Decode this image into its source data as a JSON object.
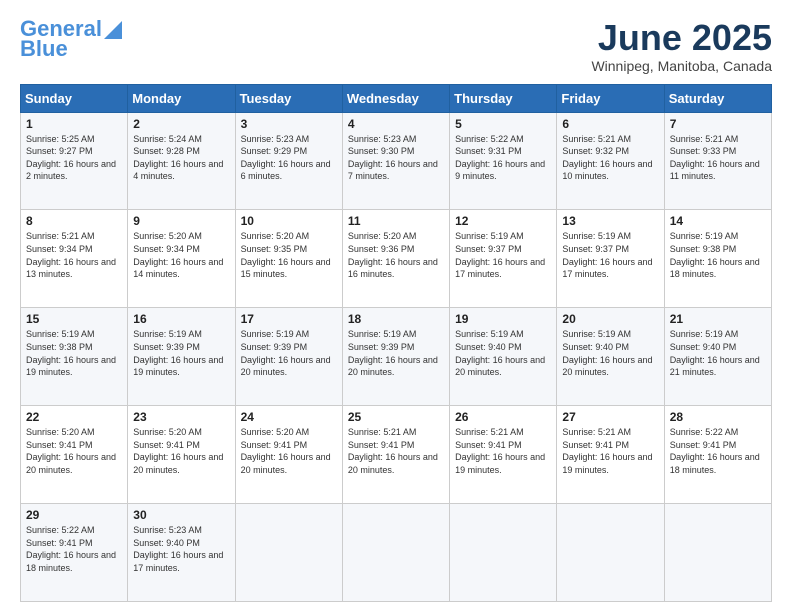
{
  "logo": {
    "line1": "General",
    "line2": "Blue"
  },
  "header": {
    "month": "June 2025",
    "location": "Winnipeg, Manitoba, Canada"
  },
  "days_of_week": [
    "Sunday",
    "Monday",
    "Tuesday",
    "Wednesday",
    "Thursday",
    "Friday",
    "Saturday"
  ],
  "weeks": [
    [
      {
        "day": "1",
        "sunrise": "5:25 AM",
        "sunset": "9:27 PM",
        "daylight": "16 hours and 2 minutes."
      },
      {
        "day": "2",
        "sunrise": "5:24 AM",
        "sunset": "9:28 PM",
        "daylight": "16 hours and 4 minutes."
      },
      {
        "day": "3",
        "sunrise": "5:23 AM",
        "sunset": "9:29 PM",
        "daylight": "16 hours and 6 minutes."
      },
      {
        "day": "4",
        "sunrise": "5:23 AM",
        "sunset": "9:30 PM",
        "daylight": "16 hours and 7 minutes."
      },
      {
        "day": "5",
        "sunrise": "5:22 AM",
        "sunset": "9:31 PM",
        "daylight": "16 hours and 9 minutes."
      },
      {
        "day": "6",
        "sunrise": "5:21 AM",
        "sunset": "9:32 PM",
        "daylight": "16 hours and 10 minutes."
      },
      {
        "day": "7",
        "sunrise": "5:21 AM",
        "sunset": "9:33 PM",
        "daylight": "16 hours and 11 minutes."
      }
    ],
    [
      {
        "day": "8",
        "sunrise": "5:21 AM",
        "sunset": "9:34 PM",
        "daylight": "16 hours and 13 minutes."
      },
      {
        "day": "9",
        "sunrise": "5:20 AM",
        "sunset": "9:34 PM",
        "daylight": "16 hours and 14 minutes."
      },
      {
        "day": "10",
        "sunrise": "5:20 AM",
        "sunset": "9:35 PM",
        "daylight": "16 hours and 15 minutes."
      },
      {
        "day": "11",
        "sunrise": "5:20 AM",
        "sunset": "9:36 PM",
        "daylight": "16 hours and 16 minutes."
      },
      {
        "day": "12",
        "sunrise": "5:19 AM",
        "sunset": "9:37 PM",
        "daylight": "16 hours and 17 minutes."
      },
      {
        "day": "13",
        "sunrise": "5:19 AM",
        "sunset": "9:37 PM",
        "daylight": "16 hours and 17 minutes."
      },
      {
        "day": "14",
        "sunrise": "5:19 AM",
        "sunset": "9:38 PM",
        "daylight": "16 hours and 18 minutes."
      }
    ],
    [
      {
        "day": "15",
        "sunrise": "5:19 AM",
        "sunset": "9:38 PM",
        "daylight": "16 hours and 19 minutes."
      },
      {
        "day": "16",
        "sunrise": "5:19 AM",
        "sunset": "9:39 PM",
        "daylight": "16 hours and 19 minutes."
      },
      {
        "day": "17",
        "sunrise": "5:19 AM",
        "sunset": "9:39 PM",
        "daylight": "16 hours and 20 minutes."
      },
      {
        "day": "18",
        "sunrise": "5:19 AM",
        "sunset": "9:39 PM",
        "daylight": "16 hours and 20 minutes."
      },
      {
        "day": "19",
        "sunrise": "5:19 AM",
        "sunset": "9:40 PM",
        "daylight": "16 hours and 20 minutes."
      },
      {
        "day": "20",
        "sunrise": "5:19 AM",
        "sunset": "9:40 PM",
        "daylight": "16 hours and 20 minutes."
      },
      {
        "day": "21",
        "sunrise": "5:19 AM",
        "sunset": "9:40 PM",
        "daylight": "16 hours and 21 minutes."
      }
    ],
    [
      {
        "day": "22",
        "sunrise": "5:20 AM",
        "sunset": "9:41 PM",
        "daylight": "16 hours and 20 minutes."
      },
      {
        "day": "23",
        "sunrise": "5:20 AM",
        "sunset": "9:41 PM",
        "daylight": "16 hours and 20 minutes."
      },
      {
        "day": "24",
        "sunrise": "5:20 AM",
        "sunset": "9:41 PM",
        "daylight": "16 hours and 20 minutes."
      },
      {
        "day": "25",
        "sunrise": "5:21 AM",
        "sunset": "9:41 PM",
        "daylight": "16 hours and 20 minutes."
      },
      {
        "day": "26",
        "sunrise": "5:21 AM",
        "sunset": "9:41 PM",
        "daylight": "16 hours and 19 minutes."
      },
      {
        "day": "27",
        "sunrise": "5:21 AM",
        "sunset": "9:41 PM",
        "daylight": "16 hours and 19 minutes."
      },
      {
        "day": "28",
        "sunrise": "5:22 AM",
        "sunset": "9:41 PM",
        "daylight": "16 hours and 18 minutes."
      }
    ],
    [
      {
        "day": "29",
        "sunrise": "5:22 AM",
        "sunset": "9:41 PM",
        "daylight": "16 hours and 18 minutes."
      },
      {
        "day": "30",
        "sunrise": "5:23 AM",
        "sunset": "9:40 PM",
        "daylight": "16 hours and 17 minutes."
      },
      null,
      null,
      null,
      null,
      null
    ]
  ],
  "labels": {
    "sunrise": "Sunrise:",
    "sunset": "Sunset:",
    "daylight": "Daylight:"
  }
}
